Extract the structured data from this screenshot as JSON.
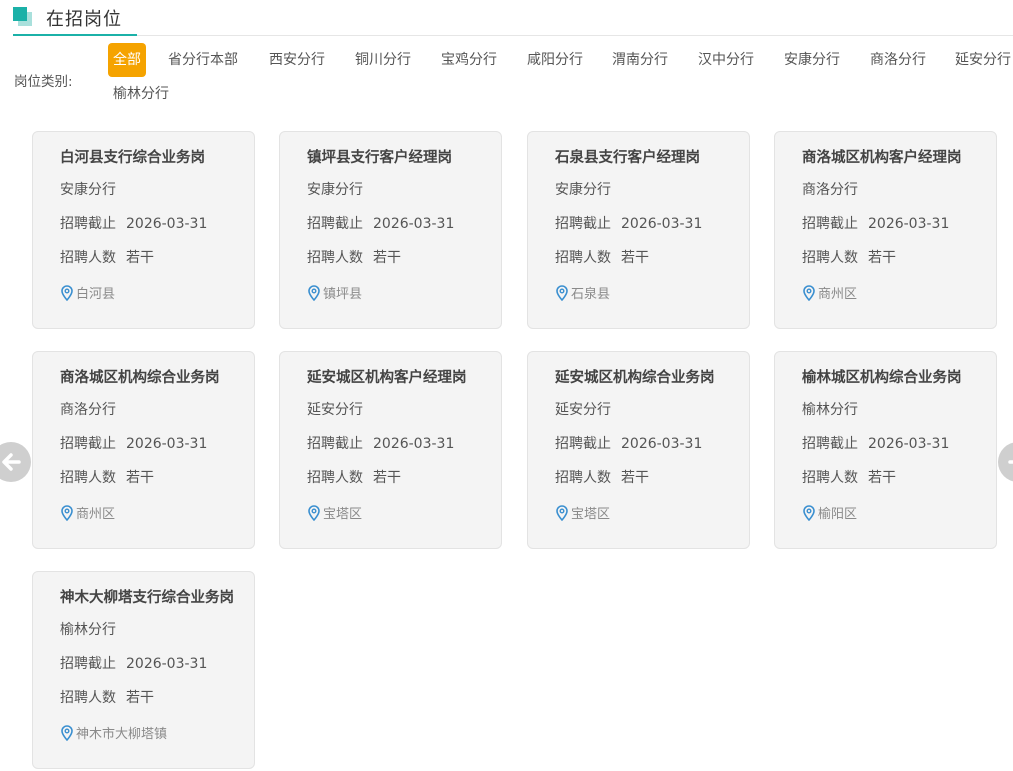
{
  "header": {
    "title": "在招岗位"
  },
  "filter": {
    "label": "岗位类别:",
    "tabs": [
      "全部",
      "省分行本部",
      "西安分行",
      "铜川分行",
      "宝鸡分行",
      "咸阳分行",
      "渭南分行",
      "汉中分行",
      "安康分行",
      "商洛分行",
      "延安分行",
      "榆林分行"
    ],
    "active_tab": "全部"
  },
  "card_labels": {
    "deadline": "招聘截止",
    "headcount": "招聘人数"
  },
  "jobs": [
    {
      "title": "白河县支行综合业务岗",
      "branch": "安康分行",
      "deadline": "2026-03-31",
      "headcount": "若干",
      "location": "白河县"
    },
    {
      "title": "镇坪县支行客户经理岗",
      "branch": "安康分行",
      "deadline": "2026-03-31",
      "headcount": "若干",
      "location": "镇坪县"
    },
    {
      "title": "石泉县支行客户经理岗",
      "branch": "安康分行",
      "deadline": "2026-03-31",
      "headcount": "若干",
      "location": "石泉县"
    },
    {
      "title": "商洛城区机构客户经理岗",
      "branch": "商洛分行",
      "deadline": "2026-03-31",
      "headcount": "若干",
      "location": "商州区"
    },
    {
      "title": "商洛城区机构综合业务岗",
      "branch": "商洛分行",
      "deadline": "2026-03-31",
      "headcount": "若干",
      "location": "商州区"
    },
    {
      "title": "延安城区机构客户经理岗",
      "branch": "延安分行",
      "deadline": "2026-03-31",
      "headcount": "若干",
      "location": "宝塔区"
    },
    {
      "title": "延安城区机构综合业务岗",
      "branch": "延安分行",
      "deadline": "2026-03-31",
      "headcount": "若干",
      "location": "宝塔区"
    },
    {
      "title": "榆林城区机构综合业务岗",
      "branch": "榆林分行",
      "deadline": "2026-03-31",
      "headcount": "若干",
      "location": "榆阳区"
    },
    {
      "title": "神木大柳塔支行综合业务岗",
      "branch": "榆林分行",
      "deadline": "2026-03-31",
      "headcount": "若干",
      "location": "神木市大柳塔镇"
    }
  ],
  "colors": {
    "accent": "#1bb1a8",
    "active_tab": "#f5a300",
    "pin": "#3a8fd0"
  },
  "icons": {
    "prev": "arrow-left-icon",
    "next": "arrow-right-icon",
    "location": "location-pin-icon"
  }
}
